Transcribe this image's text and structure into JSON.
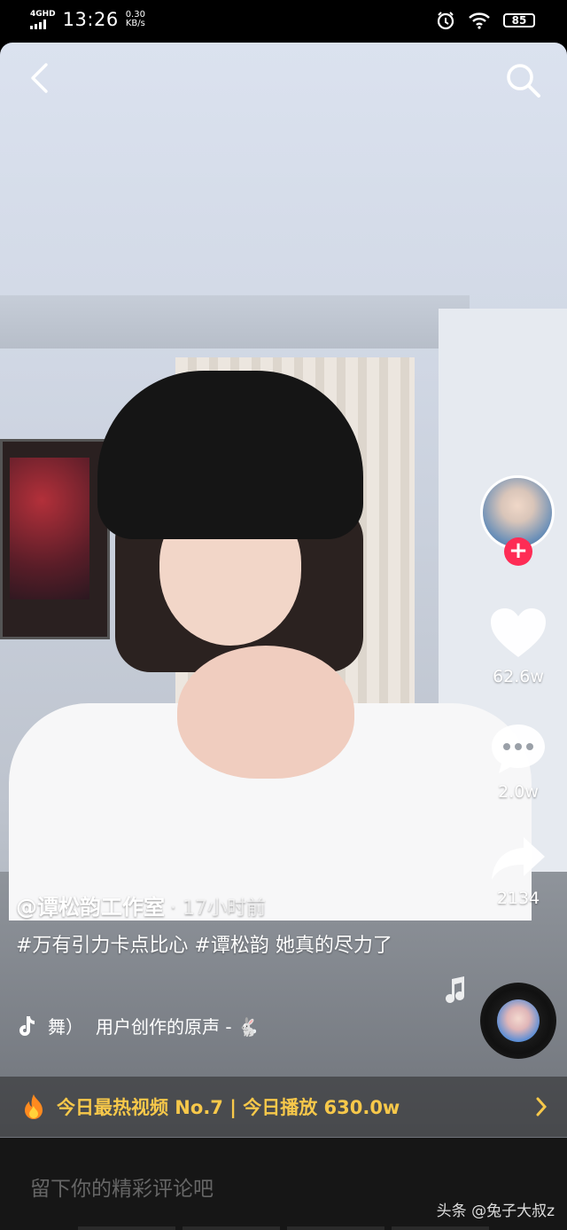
{
  "status_bar": {
    "network": "4GHD",
    "time": "13:26",
    "speed_value": "0.30",
    "speed_unit": "KB/s",
    "battery": "85",
    "icons": [
      "signal-icon",
      "alarm-icon",
      "wifi-icon",
      "battery-icon"
    ]
  },
  "top": {
    "back_icon": "chevron-left-icon",
    "search_icon": "search-icon"
  },
  "rail": {
    "likes": "62.6w",
    "comments": "2.0w",
    "shares": "2134",
    "follow_symbol": "+"
  },
  "caption": {
    "author": "@谭松韵工作室",
    "time_ago": "· 17小时前",
    "description": "#万有引力卡点比心 #谭松韵 她真的尽力了"
  },
  "music": {
    "prefix": "舞）",
    "sound_title": "用户创作的原声 - 🐇"
  },
  "hot": {
    "text": "今日最热视频 No.7 | 今日播放 630.0w",
    "color": "#f7c84a"
  },
  "comment": {
    "placeholder": "留下你的精彩评论吧",
    "watermark": "头条 @兔子大叔z"
  },
  "colors": {
    "follow": "#fe2c55",
    "hot_text": "#f7c84a",
    "comment_bg": "#161616"
  }
}
